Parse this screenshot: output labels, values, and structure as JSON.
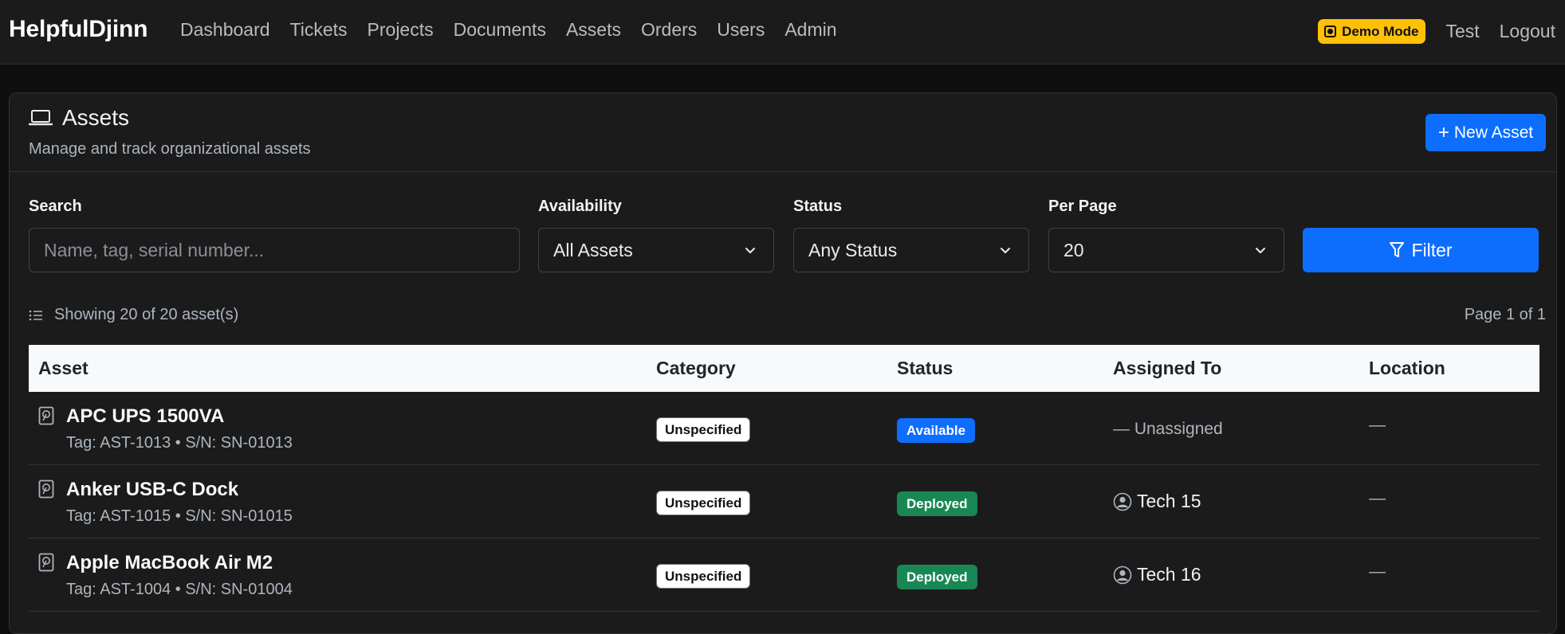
{
  "nav": {
    "brand": "HelpfulDjinn",
    "links": [
      "Dashboard",
      "Tickets",
      "Projects",
      "Documents",
      "Assets",
      "Orders",
      "Users",
      "Admin"
    ],
    "demo_badge": "Demo Mode",
    "user": "Test",
    "logout": "Logout"
  },
  "header": {
    "icon": "laptop-icon",
    "title": "Assets",
    "subtitle": "Manage and track organizational assets",
    "new_button": "New Asset"
  },
  "filters": {
    "search_label": "Search",
    "search_placeholder": "Name, tag, serial number...",
    "availability_label": "Availability",
    "availability_value": "All Assets",
    "status_label": "Status",
    "status_value": "Any Status",
    "per_page_label": "Per Page",
    "per_page_value": "20",
    "filter_button": "Filter"
  },
  "summary": {
    "showing": "Showing 20 of 20 asset(s)",
    "page": "Page 1 of 1"
  },
  "table": {
    "columns": [
      "Asset",
      "Category",
      "Status",
      "Assigned To",
      "Location"
    ],
    "rows": [
      {
        "name": "APC UPS 1500VA",
        "meta": "Tag: AST-1013 • S/N: SN-01013",
        "category": "Unspecified",
        "status": "Available",
        "assigned": "— Unassigned",
        "location": "—"
      },
      {
        "name": "Anker USB-C Dock",
        "meta": "Tag: AST-1015 • S/N: SN-01015",
        "category": "Unspecified",
        "status": "Deployed",
        "assigned": "Tech 15",
        "location": "—"
      },
      {
        "name": "Apple MacBook Air M2",
        "meta": "Tag: AST-1004 • S/N: SN-01004",
        "category": "Unspecified",
        "status": "Deployed",
        "assigned": "Tech 16",
        "location": "—"
      }
    ]
  },
  "colors": {
    "primary": "#0d6efd",
    "available": "#0d6efd",
    "deployed": "#198754",
    "warning": "#ffc107"
  }
}
